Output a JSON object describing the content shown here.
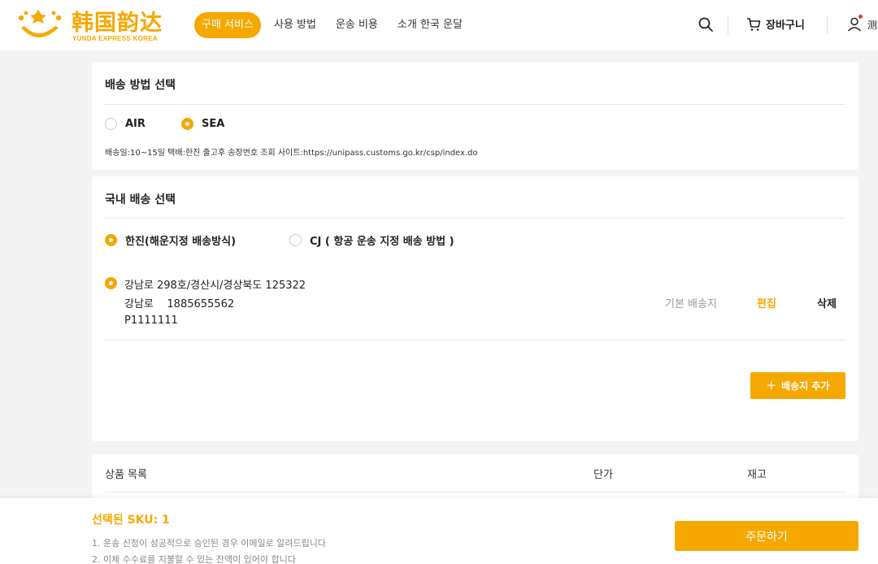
{
  "header": {
    "logo_cn": "韩国韵达",
    "logo_en": "YUNDA EXPRESS KOREA",
    "nav": [
      {
        "label": "구매 서비스",
        "active": true
      },
      {
        "label": "사용 방법",
        "active": false
      },
      {
        "label": "운송 비용",
        "active": false
      },
      {
        "label": "소개 한국 운달",
        "active": false
      }
    ],
    "search_icon": "search-icon",
    "cart_label": "장바구니",
    "cart_icon": "cart-icon",
    "user_icon": "user-icon",
    "user_name": "测"
  },
  "shipping_method": {
    "title": "배송 방법 선택",
    "options": [
      {
        "label": "AIR",
        "checked": false
      },
      {
        "label": "SEA",
        "checked": true
      }
    ],
    "note": "배송일:10~15일 택배:한진 출고후 송장번호 조회 사이트:https://unipass.customs.go.kr/csp/index.do"
  },
  "domestic": {
    "title": "국내 배송 선택",
    "carriers": [
      {
        "label": "한진(해운지정 배송방식)",
        "checked": true
      },
      {
        "label": "CJ ( 항공 운송 지정 배송 방법 )",
        "checked": false
      }
    ],
    "address": {
      "line1": "강남로 298호/경산시/경상북도 125322",
      "line2": "강남로    1885655562",
      "line3": "P1111111",
      "default_label": "기본 배송지",
      "edit_label": "편집",
      "delete_label": "삭제"
    },
    "add_button": "배송지 추가"
  },
  "products": {
    "columns": [
      "상품 목록",
      "단가",
      "재고"
    ]
  },
  "footer": {
    "sku": "선택된 SKU: 1",
    "notes": [
      "1. 운송 신청이 성공적으로 승인된 경우 이메일로 알려드립니다",
      "2. 이체 수수료를 지불할 수 있는 잔액이 있어야 합니다"
    ],
    "order_button": "주문하기"
  },
  "colors": {
    "accent": "#f5a800",
    "background": "#f4f4f4"
  }
}
